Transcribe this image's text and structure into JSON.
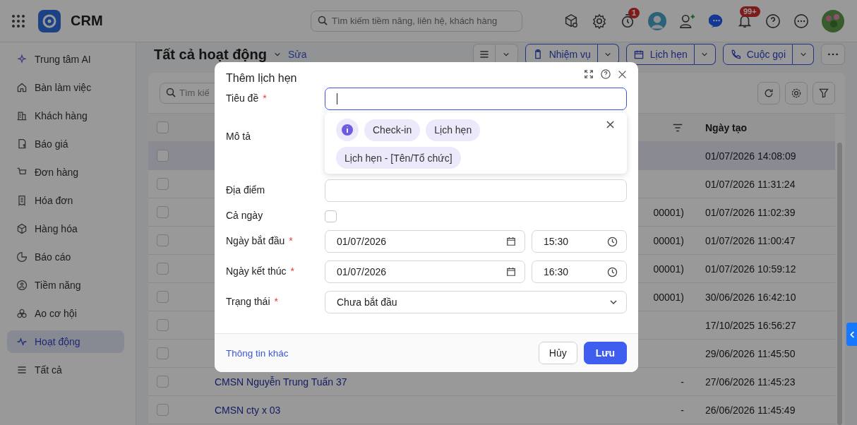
{
  "topbar": {
    "app_name": "CRM",
    "search": {
      "placeholder": "Tìm kiếm tiềm năng, liên hệ, khách hàng"
    },
    "timer_badge": "1",
    "notification_badge": "99+"
  },
  "sidebar": {
    "items": [
      {
        "label": "Trung tâm AI",
        "selected": false
      },
      {
        "label": "Bàn làm việc",
        "selected": false
      },
      {
        "label": "Khách hàng",
        "selected": false
      },
      {
        "label": "Báo giá",
        "selected": false
      },
      {
        "label": "Đơn hàng",
        "selected": false
      },
      {
        "label": "Hóa đơn",
        "selected": false
      },
      {
        "label": "Hàng hóa",
        "selected": false
      },
      {
        "label": "Báo cáo",
        "selected": false
      },
      {
        "label": "Tiềm năng",
        "selected": false
      },
      {
        "label": "Ao cơ hội",
        "selected": false
      },
      {
        "label": "Hoạt động",
        "selected": true
      },
      {
        "label": "Tất cả",
        "selected": false
      }
    ]
  },
  "page": {
    "title": "Tất cả hoạt động",
    "edit_link": "Sửa",
    "actions": [
      {
        "label": "Nhiệm vụ"
      },
      {
        "label": "Lịch hẹn"
      },
      {
        "label": "Cuộc gọi"
      }
    ]
  },
  "table": {
    "search": {
      "placeholder": "Tìm kiế"
    },
    "select_all": {
      "checked": false
    },
    "columns": [
      {
        "label": "Ngày tạo"
      }
    ],
    "rows": [
      {
        "selected": true,
        "checked": false,
        "created": "01/07/2026 14:08:09"
      },
      {
        "selected": false,
        "checked": false,
        "created": "01/07/2026 11:31:24"
      },
      {
        "selected": false,
        "checked": false,
        "column_3": "00001)",
        "created": "01/07/2026 11:02:39"
      },
      {
        "selected": false,
        "checked": false,
        "column_3": "00001)",
        "created": "01/07/2026 11:00:47"
      },
      {
        "selected": false,
        "checked": false,
        "column_3": "00001)",
        "created": "01/07/2026 10:59:12"
      },
      {
        "selected": false,
        "checked": false,
        "column_3": "00001)",
        "created": "30/06/2026 16:42:10"
      },
      {
        "selected": false,
        "checked": false,
        "created": "17/10/2025 16:56:27"
      },
      {
        "selected": false,
        "checked": false,
        "created": "29/06/2026 11:45:50"
      },
      {
        "selected": false,
        "checked": false,
        "name": "CMSN Nguyễn Trung Tuấn 37",
        "column_3": "-",
        "created": "27/06/2026 11:45:23"
      },
      {
        "selected": false,
        "checked": false,
        "name": "CMSN cty x 03",
        "column_3": "-",
        "created": "26/06/2026 11:45:49"
      }
    ]
  },
  "modal": {
    "title": "Thêm lịch hẹn",
    "fields": [
      {
        "kind": "text",
        "label": "Tiêu đề",
        "required_mark": "*",
        "focused": true
      },
      {
        "kind": "textarea",
        "label": "Mô tả"
      },
      {
        "kind": "text",
        "label": "Địa điểm",
        "focused": false
      },
      {
        "kind": "checkbox",
        "label": "Cả ngày",
        "checked": false
      },
      {
        "kind": "datetime",
        "label": "Ngày bắt đầu",
        "required_mark": "*",
        "date": "01/07/2026",
        "time": "15:30"
      },
      {
        "kind": "datetime",
        "label": "Ngày kết thúc",
        "required_mark": "*",
        "date": "01/07/2026",
        "time": "16:30"
      },
      {
        "kind": "select",
        "label": "Trạng thái",
        "required_mark": "*",
        "value": "Chưa bắt đầu"
      }
    ],
    "suggestion_rows": [
      [
        "Check-in",
        "Lịch hẹn"
      ],
      [
        "Lịch hẹn - [Tên/Tổ chức]"
      ]
    ],
    "more_link": "Thông tin khác",
    "buttons": [
      {
        "label": "Hủy",
        "kind": "secondary"
      },
      {
        "label": "Lưu",
        "kind": "primary"
      }
    ]
  }
}
